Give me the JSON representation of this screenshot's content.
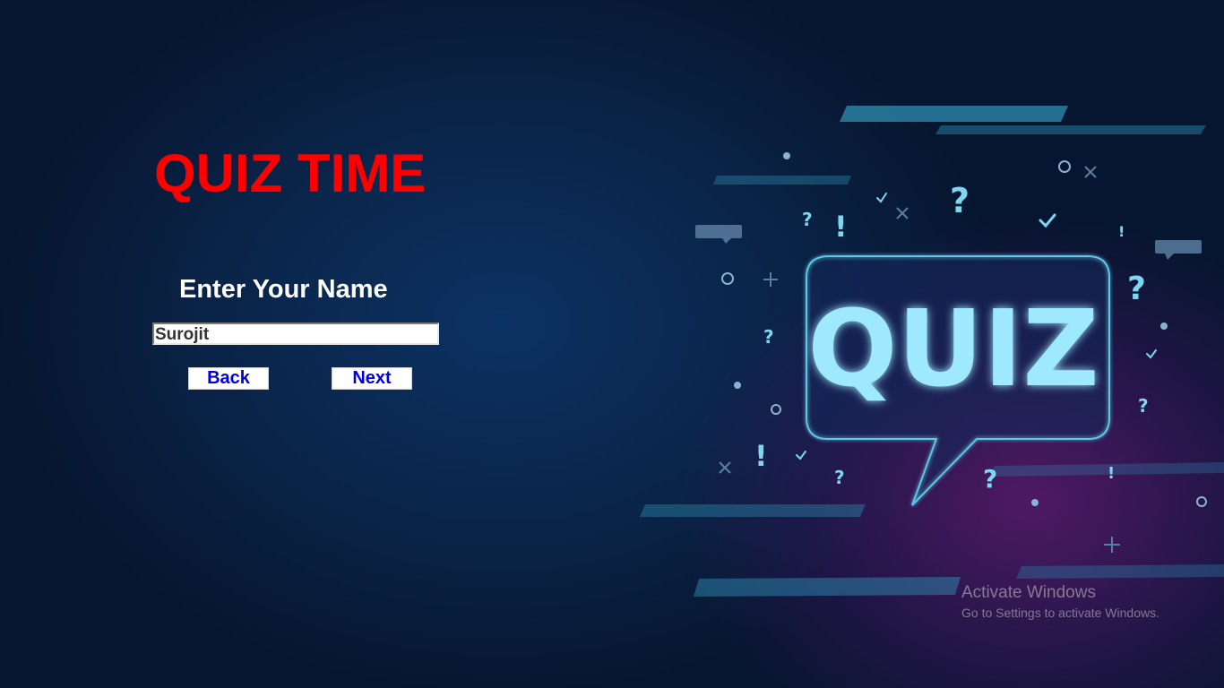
{
  "title": "QUIZ TIME",
  "prompt": "Enter Your Name",
  "name_input": {
    "value": "Surojit"
  },
  "buttons": {
    "back": "Back",
    "next": "Next"
  },
  "artwork": {
    "banner_text": "QUIZ",
    "icons": [
      "question-mark-icon",
      "exclamation-icon",
      "checkmark-icon",
      "cross-icon",
      "circle-icon",
      "plus-icon",
      "chat-bubble-icon"
    ]
  },
  "watermark": {
    "title": "Activate Windows",
    "subtitle": "Go to Settings to activate Windows."
  },
  "colors": {
    "title": "#ff0000",
    "button_text": "#0000dd",
    "glow": "#7fe3ff",
    "background": "#0a2448"
  }
}
